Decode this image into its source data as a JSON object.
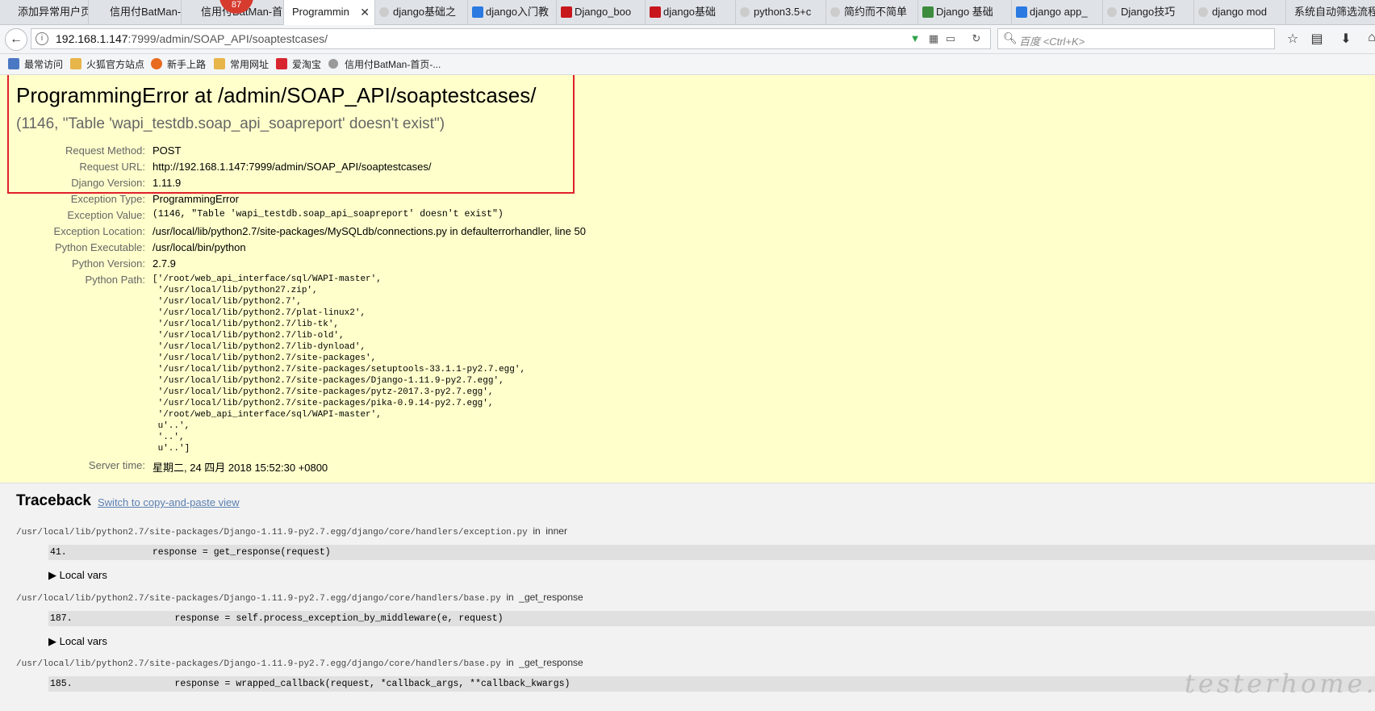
{
  "browser": {
    "tabs": [
      {
        "label": "添加异常用户页",
        "color": "#ffffff"
      },
      {
        "label": "信用付BatMan-首",
        "color": "#ffffff"
      },
      {
        "label": "信用付BatMan-首",
        "color": "#ffffff"
      },
      {
        "label": "Programmin",
        "color": "#ffffff"
      },
      {
        "label": "django基础之",
        "color": "#ffffff"
      },
      {
        "label": "django入门教",
        "color": "#2a7ae2"
      },
      {
        "label": "Django_boo",
        "color": "#c8161d"
      },
      {
        "label": "django基础",
        "color": "#c8161d"
      },
      {
        "label": "python3.5+c",
        "color": "#ffffff"
      },
      {
        "label": "简约而不简单",
        "color": "#ffffff"
      },
      {
        "label": "Django 基础",
        "color": "#3d8b3d"
      },
      {
        "label": "django app_",
        "color": "#2a7ae2"
      },
      {
        "label": "Django技巧",
        "color": "#ffffff"
      },
      {
        "label": "django mod",
        "color": "#ffffff"
      },
      {
        "label": "系统自动筛选流程",
        "color": "#ffffff"
      }
    ],
    "tab_close_glyph": "✕",
    "notification_count": "87",
    "url_host": "192.168.1.147",
    "url_path": ":7999/admin/SOAP_API/soaptestcases/",
    "search_placeholder": "百度 <Ctrl+K>",
    "bookmarks": [
      {
        "label": "最常访问",
        "color": "#4a78c2"
      },
      {
        "label": "火狐官方站点",
        "color": "#e8b54a"
      },
      {
        "label": "新手上路",
        "color": "#e86a1f"
      },
      {
        "label": "常用网址",
        "color": "#e8b54a"
      },
      {
        "label": "爱淘宝",
        "color": "#d8262f"
      },
      {
        "label": "信用付BatMan-首页-...",
        "color": "#9a9a9a"
      }
    ]
  },
  "error": {
    "title": "ProgrammingError at /admin/SOAP_API/soaptestcases/",
    "message": "(1146, \"Table 'wapi_testdb.soap_api_soapreport' doesn't exist\")",
    "meta": [
      {
        "key": "Request Method:",
        "value": "POST"
      },
      {
        "key": "Request URL:",
        "value": "http://192.168.1.147:7999/admin/SOAP_API/soaptestcases/"
      },
      {
        "key": "Django Version:",
        "value": "1.11.9"
      },
      {
        "key": "Exception Type:",
        "value": "ProgrammingError"
      },
      {
        "key": "Exception Value:",
        "value": "(1146, \"Table 'wapi_testdb.soap_api_soapreport' doesn't exist\")"
      },
      {
        "key": "Exception Location:",
        "value": "/usr/local/lib/python2.7/site-packages/MySQLdb/connections.py in defaulterrorhandler, line 50"
      },
      {
        "key": "Python Executable:",
        "value": "/usr/local/bin/python"
      },
      {
        "key": "Python Version:",
        "value": "2.7.9"
      },
      {
        "key": "Python Path:",
        "value": ""
      },
      {
        "key": "Server time:",
        "value": "星期二, 24 四月 2018 15:52:30 +0800"
      }
    ],
    "python_path": "['/root/web_api_interface/sql/WAPI-master',\n '/usr/local/lib/python27.zip',\n '/usr/local/lib/python2.7',\n '/usr/local/lib/python2.7/plat-linux2',\n '/usr/local/lib/python2.7/lib-tk',\n '/usr/local/lib/python2.7/lib-old',\n '/usr/local/lib/python2.7/lib-dynload',\n '/usr/local/lib/python2.7/site-packages',\n '/usr/local/lib/python2.7/site-packages/setuptools-33.1.1-py2.7.egg',\n '/usr/local/lib/python2.7/site-packages/Django-1.11.9-py2.7.egg',\n '/usr/local/lib/python2.7/site-packages/pytz-2017.3-py2.7.egg',\n '/usr/local/lib/python2.7/site-packages/pika-0.9.14-py2.7.egg',\n '/root/web_api_interface/sql/WAPI-master',\n u'..',\n '..',\n u'..']"
  },
  "traceback": {
    "title": "Traceback",
    "switch_link": "Switch to copy-and-paste view",
    "local_vars_label": "Local vars",
    "frames": [
      {
        "file": "/usr/local/lib/python2.7/site-packages/Django-1.11.9-py2.7.egg/django/core/handlers/exception.py",
        "in_word": "in",
        "func": "inner",
        "lineno": "41.",
        "code": "            response = get_response(request)"
      },
      {
        "file": "/usr/local/lib/python2.7/site-packages/Django-1.11.9-py2.7.egg/django/core/handlers/base.py",
        "in_word": "in",
        "func": "_get_response",
        "lineno": "187.",
        "code": "                response = self.process_exception_by_middleware(e, request)"
      },
      {
        "file": "/usr/local/lib/python2.7/site-packages/Django-1.11.9-py2.7.egg/django/core/handlers/base.py",
        "in_word": "in",
        "func": "_get_response",
        "lineno": "185.",
        "code": "                response = wrapped_callback(request, *callback_args, **callback_kwargs)"
      }
    ]
  },
  "watermark": "testerhome.com"
}
